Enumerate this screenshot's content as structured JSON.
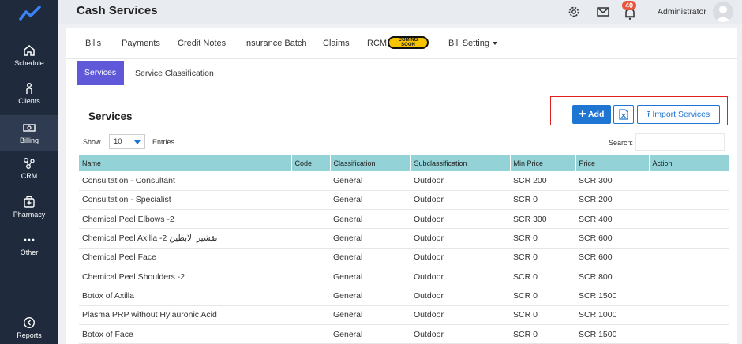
{
  "sidebar": {
    "logo": "app-logo",
    "items": [
      {
        "label": "Schedule",
        "icon": "home-icon"
      },
      {
        "label": "Clients",
        "icon": "person-icon"
      },
      {
        "label": "Billing",
        "icon": "money-icon"
      },
      {
        "label": "CRM",
        "icon": "network-icon"
      },
      {
        "label": "Pharmacy",
        "icon": "medicine-icon"
      },
      {
        "label": "Other",
        "icon": "more-dots-icon"
      },
      {
        "label": "Reports",
        "icon": "reports-icon"
      }
    ],
    "active": "Billing"
  },
  "header": {
    "title": "Cash Services",
    "notification_count": "40",
    "user": "Administrator"
  },
  "tabs": {
    "bills": "Bills",
    "payments": "Payments",
    "credit_notes": "Credit Notes",
    "insurance_batch": "Insurance Batch",
    "claims": "Claims",
    "rcm": "RCM",
    "coming_soon_1": "COMING",
    "coming_soon_2": "SOON",
    "bill_setting": "Bill Setting"
  },
  "subtabs": {
    "services": "Services",
    "classification": "Service Classification"
  },
  "section": {
    "title": "Services",
    "add_label": "Add",
    "import_label": "Import Services"
  },
  "controls": {
    "show_label": "Show",
    "entries_value": "10",
    "entries_label": "Entries",
    "search_label": "Search:",
    "search_value": ""
  },
  "table": {
    "columns": [
      "Name",
      "Code",
      "Classification",
      "Subclassification",
      "Min Price",
      "Price",
      "Action"
    ],
    "rows": [
      [
        "Consultation - Consultant",
        "",
        "General",
        "Outdoor",
        "SCR 200",
        "SCR 300",
        ""
      ],
      [
        "Consultation - Specialist",
        "",
        "General",
        "Outdoor",
        "SCR 0",
        "SCR 200",
        ""
      ],
      [
        "Chemical Peel Elbows -2",
        "",
        "General",
        "Outdoor",
        "SCR 300",
        "SCR 400",
        ""
      ],
      [
        "Chemical Peel Axilla -2 تقشير الابطين",
        "",
        "General",
        "Outdoor",
        "SCR 0",
        "SCR 600",
        ""
      ],
      [
        "Chemical Peel Face",
        "",
        "General",
        "Outdoor",
        "SCR 0",
        "SCR 600",
        ""
      ],
      [
        "Chemical Peel Shoulders -2",
        "",
        "General",
        "Outdoor",
        "SCR 0",
        "SCR 800",
        ""
      ],
      [
        "Botox of Axilla",
        "",
        "General",
        "Outdoor",
        "SCR 0",
        "SCR 1500",
        ""
      ],
      [
        "Plasma PRP without Hylauronic Acid",
        "",
        "General",
        "Outdoor",
        "SCR 0",
        "SCR 1000",
        ""
      ],
      [
        "Botox of Face",
        "",
        "General",
        "Outdoor",
        "SCR 0",
        "SCR 1500",
        ""
      ]
    ]
  }
}
